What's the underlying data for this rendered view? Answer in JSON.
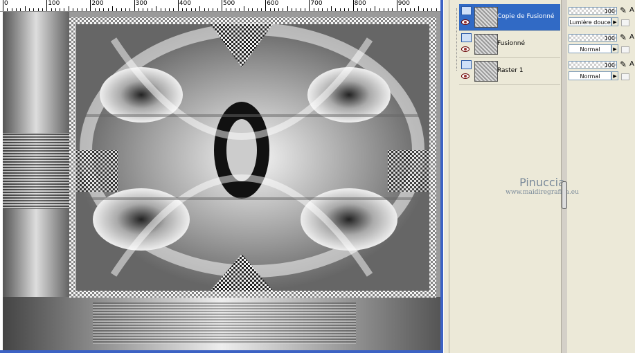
{
  "ruler": {
    "labels": [
      "0",
      "100",
      "200",
      "300",
      "400",
      "500",
      "600",
      "700",
      "800",
      "900"
    ]
  },
  "layers": [
    {
      "name": "Copie de Fusionné",
      "selected": true
    },
    {
      "name": "Fusionné",
      "selected": false
    },
    {
      "name": "Raster 1",
      "selected": false
    }
  ],
  "properties": [
    {
      "opacity": "100",
      "blend_mode": "Lumière douce",
      "extra": "A"
    },
    {
      "opacity": "100",
      "blend_mode": "Normal",
      "extra": "A"
    },
    {
      "opacity": "100",
      "blend_mode": "Normal",
      "extra": "A"
    }
  ],
  "watermark": {
    "name": "Pinuccia",
    "url": "www.maidiregrafica.eu"
  },
  "colors": {
    "selection": "#316ac5",
    "panel_bg": "#ece9d8",
    "window_border": "#3c62c4"
  }
}
